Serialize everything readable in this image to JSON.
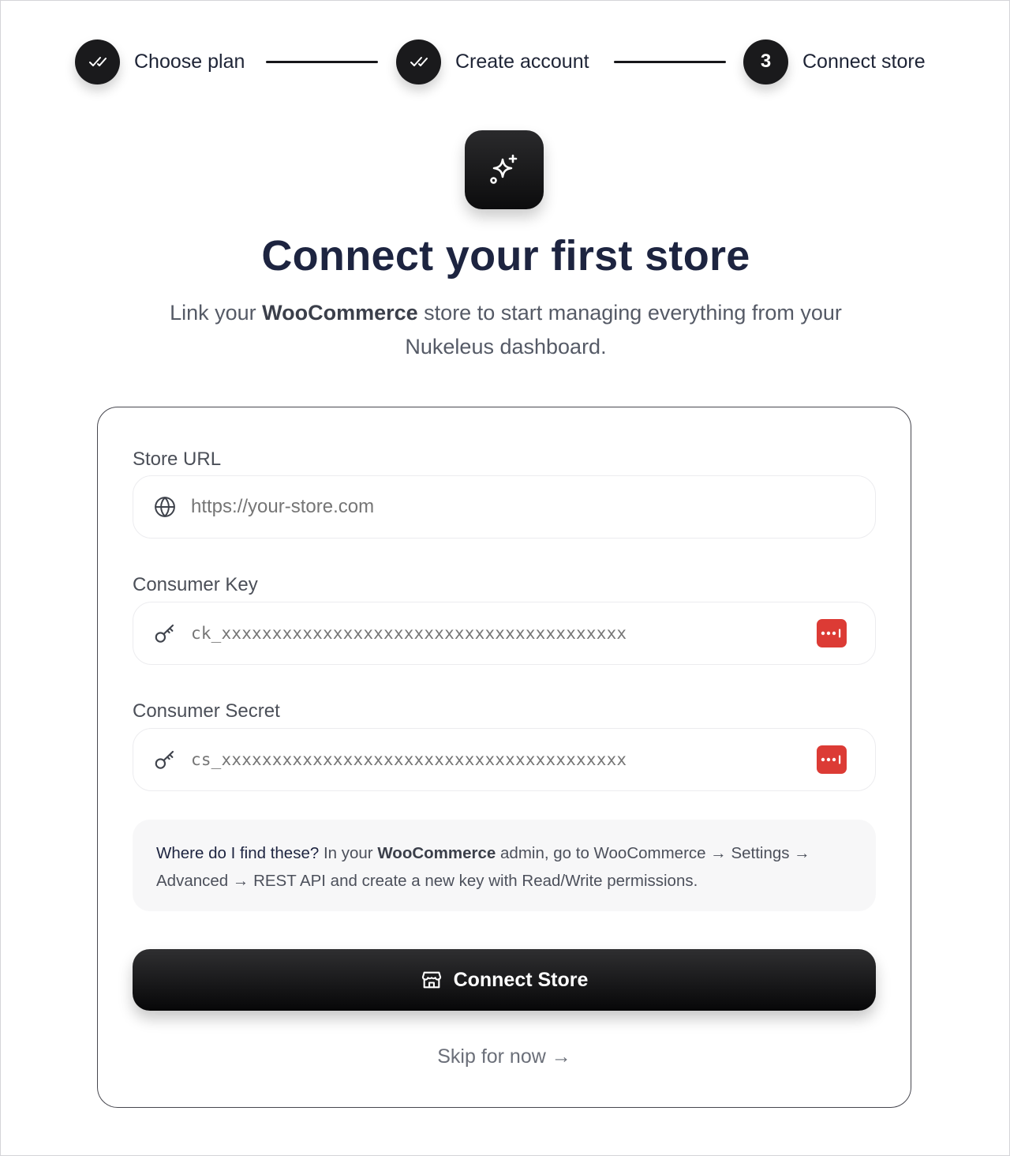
{
  "stepper": {
    "steps": [
      {
        "label": "Choose plan",
        "state": "completed",
        "icon": "double-check-icon"
      },
      {
        "label": "Create account",
        "state": "completed",
        "icon": "double-check-icon"
      },
      {
        "label": "Connect store",
        "state": "current",
        "number": "3"
      }
    ]
  },
  "hero": {
    "icon": "sparkles-icon",
    "title": "Connect your first store",
    "subtitle_pre": "Link your ",
    "subtitle_brand": "WooCommerce",
    "subtitle_post": " store to start managing everything from your Nukeleus dashboard."
  },
  "form": {
    "store_url": {
      "label": "Store URL",
      "placeholder": "https://your-store.com",
      "icon": "globe-icon"
    },
    "consumer_key": {
      "label": "Consumer Key",
      "placeholder": "ck_xxxxxxxxxxxxxxxxxxxxxxxxxxxxxxxxxxxxxxxx",
      "icon": "key-icon",
      "badge_icon": "password-manager-icon"
    },
    "consumer_secret": {
      "label": "Consumer Secret",
      "placeholder": "cs_xxxxxxxxxxxxxxxxxxxxxxxxxxxxxxxxxxxxxxxx",
      "icon": "key-icon",
      "badge_icon": "password-manager-icon"
    }
  },
  "hint": {
    "question": "Where do I find these?",
    "text_1": " In your ",
    "brand": "WooCommerce",
    "text_2": " admin, go to WooCommerce → Settings → Advanced → REST API and create a new key with Read/Write permissions."
  },
  "actions": {
    "connect_label": "Connect Store",
    "connect_icon": "store-icon",
    "skip_label": "Skip for now →"
  },
  "colors": {
    "primary": "#111113",
    "heading": "#1d2440",
    "badge": "#dc3b35",
    "card_border": "#47474f"
  }
}
